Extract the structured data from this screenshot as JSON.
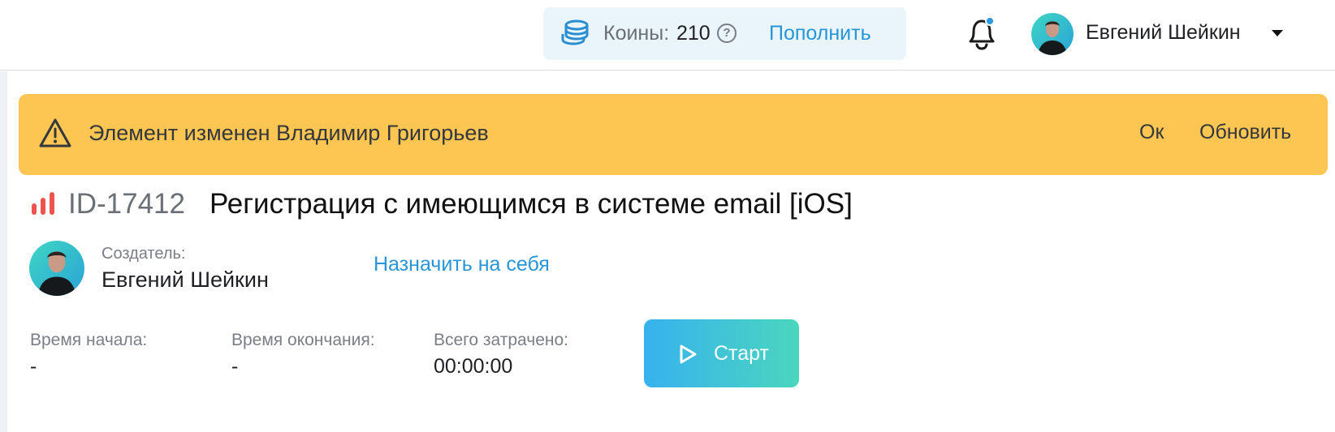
{
  "header": {
    "coins_label": "Коины:",
    "coins_value": "210",
    "help_symbol": "?",
    "topup_label": "Пополнить",
    "user_name": "Евгений Шейкин"
  },
  "banner": {
    "message": "Элемент изменен Владимир Григорьев",
    "ok_label": "Ок",
    "refresh_label": "Обновить",
    "color": "#fdc652"
  },
  "task": {
    "id": "ID-17412",
    "title": "Регистрация с имеющимся в системе email [iOS]",
    "creator_label": "Создатель:",
    "creator_name": "Евгений Шейкин",
    "assign_label": "Назначить на себя"
  },
  "timer": {
    "start_label": "Время начала:",
    "start_value": "-",
    "end_label": "Время окончания:",
    "end_value": "-",
    "total_label": "Всего затрачено:",
    "total_value": "00:00:00",
    "button_label": "Старт"
  },
  "colors": {
    "accent": "#2796d6",
    "priority": "#ef5350",
    "button_gradient_start": "#37b2ee",
    "button_gradient_end": "#4ad6be"
  },
  "icons": {
    "coins": "coins-stack-icon",
    "help": "question-circle-icon",
    "bell": "bell-icon",
    "caret": "caret-down-icon",
    "warning": "warning-triangle-icon",
    "priority": "priority-bars-icon",
    "play": "play-icon"
  }
}
